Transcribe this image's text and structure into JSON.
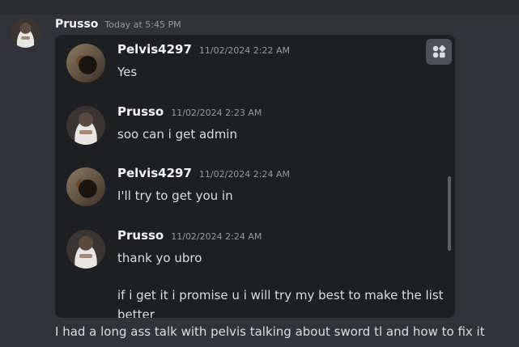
{
  "outer": {
    "author": "Prusso",
    "timestamp": "Today at 5:45 PM",
    "caption": "I had a long ass talk with pelvis talking about sword tl and how to fix it"
  },
  "messages": [
    {
      "author": "Pelvis4297",
      "timestamp": "11/02/2024 2:22 AM",
      "text": "Yes",
      "avatar": "dog"
    },
    {
      "author": "Prusso",
      "timestamp": "11/02/2024 2:23 AM",
      "text": "soo can i get admin",
      "avatar": "white"
    },
    {
      "author": "Pelvis4297",
      "timestamp": "11/02/2024 2:24 AM",
      "text": "I'll try to get you in",
      "avatar": "dog"
    },
    {
      "author": "Prusso",
      "timestamp": "11/02/2024 2:24 AM",
      "text": "thank yo ubro",
      "text2": "if i get it i promise u i will try my best to make the list better",
      "avatar": "white"
    }
  ],
  "icons": {
    "corner": "app-grid-icon"
  }
}
